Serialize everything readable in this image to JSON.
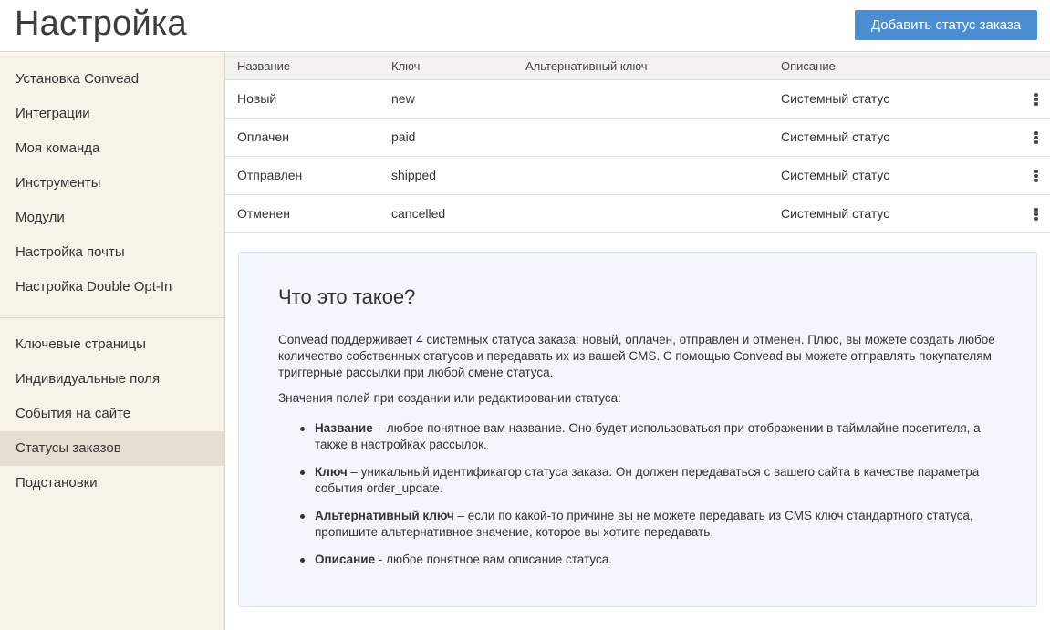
{
  "header": {
    "title": "Настройка",
    "add_button": "Добавить статус заказа"
  },
  "sidebar": {
    "group1": [
      {
        "label": "Установка Convead"
      },
      {
        "label": "Интеграции"
      },
      {
        "label": "Моя команда"
      },
      {
        "label": "Инструменты"
      },
      {
        "label": "Модули"
      },
      {
        "label": "Настройка почты"
      },
      {
        "label": "Настройка Double Opt-In"
      }
    ],
    "group2": [
      {
        "label": "Ключевые страницы"
      },
      {
        "label": "Индивидуальные поля"
      },
      {
        "label": "События на сайте"
      },
      {
        "label": "Статусы заказов",
        "active": true
      },
      {
        "label": "Подстановки"
      }
    ]
  },
  "table": {
    "columns": [
      "Название",
      "Ключ",
      "Альтернативный ключ",
      "Описание"
    ],
    "rows": [
      {
        "name": "Новый",
        "key": "new",
        "alt_key": "",
        "description": "Системный статус"
      },
      {
        "name": "Оплачен",
        "key": "paid",
        "alt_key": "",
        "description": "Системный статус"
      },
      {
        "name": "Отправлен",
        "key": "shipped",
        "alt_key": "",
        "description": "Системный статус"
      },
      {
        "name": "Отменен",
        "key": "cancelled",
        "alt_key": "",
        "description": "Системный статус"
      }
    ]
  },
  "info": {
    "title": "Что это такое?",
    "paragraph1": "Convead поддерживает 4 системных статуса заказа: новый, оплачен, отправлен и отменен. Плюс, вы можете создать любое количество собственных статусов и передавать их из вашей CMS. С помощью Convead вы можете отправлять покупателям триггерные рассылки при любой смене статуса.",
    "paragraph2": "Значения полей при создании или редактировании статуса:",
    "items": [
      {
        "term": "Название",
        "text": " – любое понятное вам название. Оно будет использоваться при отображении в таймлайне посетителя, а также в настройках рассылок."
      },
      {
        "term": "Ключ",
        "text": " – уникальный идентификатор статуса заказа. Он должен передаваться с вашего сайта в качестве параметра события order_update."
      },
      {
        "term": "Альтернативный ключ",
        "text": " – если по какой-то причине вы не можете передавать из CMS ключ стандартного статуса, пропишите альтернативное значение, которое вы хотите передавать."
      },
      {
        "term": "Описание",
        "text": " - любое понятное вам описание статуса."
      }
    ]
  },
  "colors": {
    "accent": "#4a8ed1",
    "sidebar_bg": "#f8f3e8",
    "sidebar_active": "#e6dfd1",
    "info_bg": "#f3f6fc"
  },
  "icons": {
    "row_menu": "vertical-dots-icon"
  }
}
